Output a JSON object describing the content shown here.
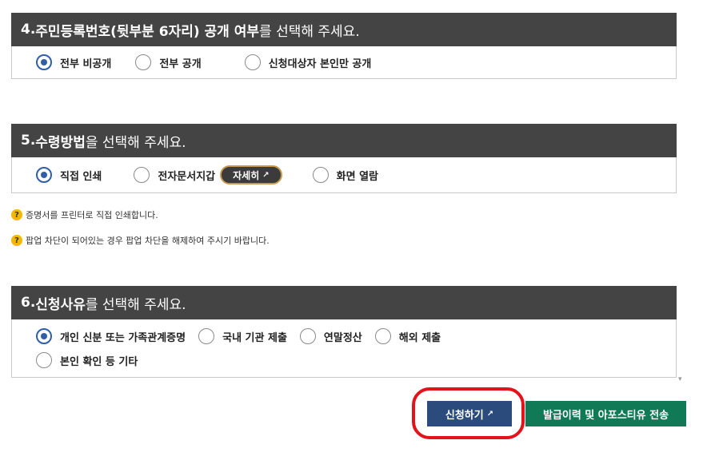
{
  "section4": {
    "title_num": "4. ",
    "title_strong": "주민등록번호(뒷부분 6자리) 공개 여부",
    "title_rest": "를 선택해 주세요.",
    "options": [
      "전부 비공개",
      "전부 공개",
      "신청대상자 본인만 공개"
    ],
    "selected": 0
  },
  "section5": {
    "title_num": "5. ",
    "title_strong": "수령방법",
    "title_rest": "을 선택해 주세요.",
    "options": [
      "직접 인쇄",
      "전자문서지갑",
      "화면 열람"
    ],
    "detail_button": "자세히",
    "selected": 0,
    "notes": [
      "증명서를 프린터로 직접 인쇄합니다.",
      "팝업 차단이 되어있는 경우 팝업 차단을 해제하여 주시기 바랍니다."
    ]
  },
  "section6": {
    "title_num": "6. ",
    "title_strong": "신청사유",
    "title_rest": "를 선택해 주세요.",
    "options": [
      "개인 신분 또는 가족관계증명",
      "국내 기관 제출",
      "연말정산",
      "해외 제출",
      "본인 확인 등 기타"
    ],
    "selected": 0
  },
  "buttons": {
    "apply": "신청하기",
    "history": "발급이력 및 아포스티유 전송"
  },
  "icons": {
    "external_link": "↗",
    "question": "?"
  },
  "colors": {
    "header_bg": "#444444",
    "radio_selected": "#2f5fa7",
    "apply_button": "#2c4b7d",
    "history_button": "#0f7a55",
    "highlight": "#e3121b"
  }
}
